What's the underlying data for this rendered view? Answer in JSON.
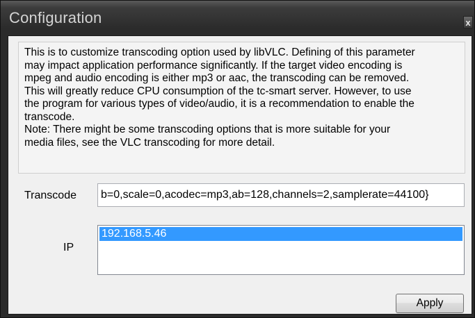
{
  "window": {
    "title": "Configuration",
    "close_glyph": "x"
  },
  "description": {
    "lines": [
      "This is to customize transcoding option used by libVLC. Defining of this parameter",
      "may impact application performance significantly. If the target video encoding is",
      "mpeg and audio encoding is either mp3 or aac, the transcoding can be removed.",
      "This will greatly reduce CPU consumption of the tc-smart server. However, to use",
      "the program for various types of video/audio, it is a recommendation to enable the",
      "transcode.",
      "Note: There might be some transcoding options that is more suitable for your",
      "media files, see the VLC transcoding for more detail."
    ]
  },
  "form": {
    "transcode_label": "Transcode",
    "transcode_value": "b=0,scale=0,acodec=mp3,ab=128,channels=2,samplerate=44100}",
    "ip_label": "IP",
    "ip_items": [
      "192.168.5.46"
    ]
  },
  "buttons": {
    "apply_label": "Apply"
  },
  "colors": {
    "selection": "#3399ff",
    "client_bg": "#f0f0f0",
    "frame": "#2b2b2b"
  }
}
